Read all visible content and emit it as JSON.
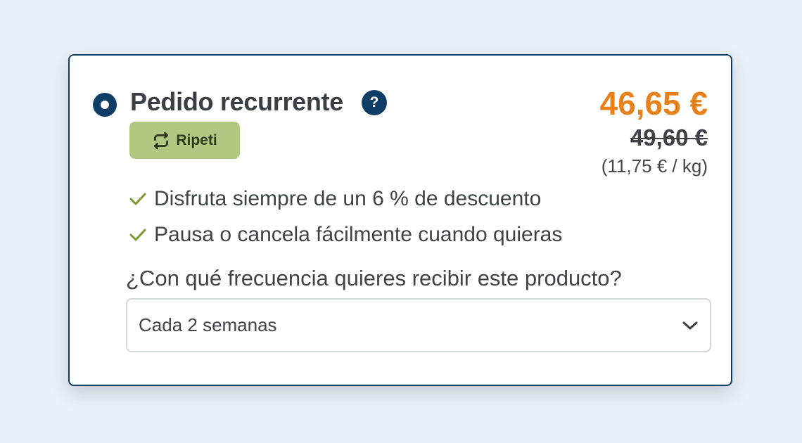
{
  "option": {
    "title": "Pedido recurrente",
    "help_icon": "question-icon",
    "help_symbol": "?",
    "badge": {
      "icon": "repeat-icon",
      "label": "Ripeti",
      "color": "#b2c882"
    },
    "selected": true
  },
  "price": {
    "current": "46,65 €",
    "original": "49,60 €",
    "per_unit": "(11,75 € / kg)",
    "accent_color": "#e7811a"
  },
  "benefits": [
    {
      "icon": "check-icon",
      "text": "Disfruta siempre de un 6 % de descuento"
    },
    {
      "icon": "check-icon",
      "text": "Pausa o cancela fácilmente cuando quieras"
    }
  ],
  "frequency": {
    "question": "¿Con qué frecuencia quieres recibir este producto?",
    "selected_value": "Cada 2 semanas",
    "icon": "chevron-down-icon"
  },
  "colors": {
    "primary": "#0f3d66",
    "check": "#7a9a2f",
    "background": "#eaf0f7"
  }
}
